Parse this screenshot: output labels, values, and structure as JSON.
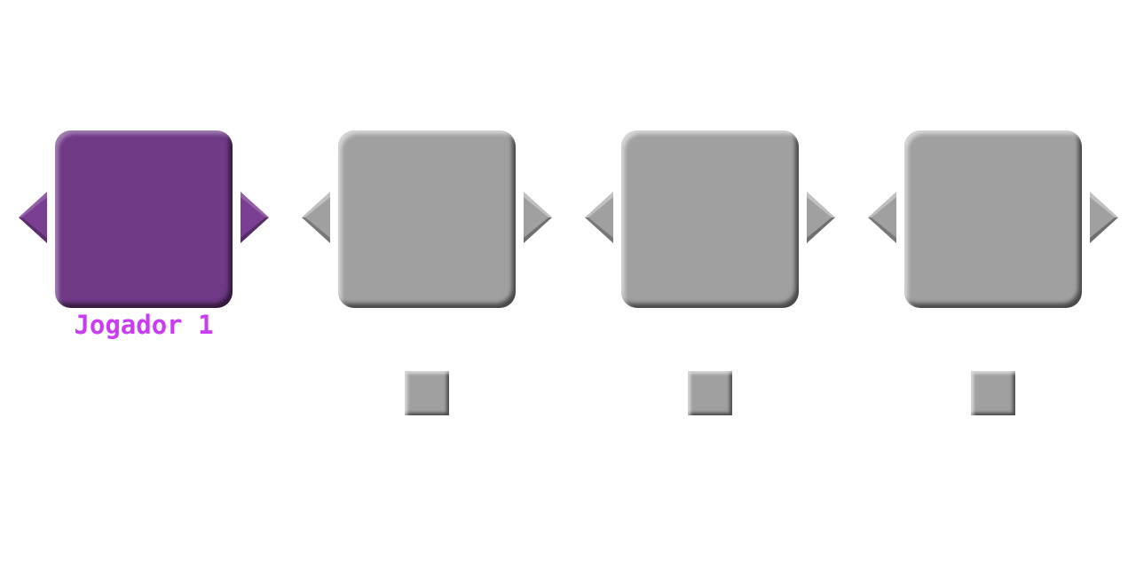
{
  "players": [
    {
      "label": "Jogador 1",
      "active": true
    },
    {
      "label": "",
      "active": false
    },
    {
      "label": "",
      "active": false
    },
    {
      "label": "",
      "active": false
    }
  ],
  "colors": {
    "active_fill": "#6f3986",
    "active_arrow": "#7a3f92",
    "inactive_fill": "#a0a0a0",
    "label_text": "#c93cf2",
    "background": "#ffffff"
  },
  "icons": {
    "prev": "triangle-left-icon",
    "next": "triangle-right-icon"
  }
}
